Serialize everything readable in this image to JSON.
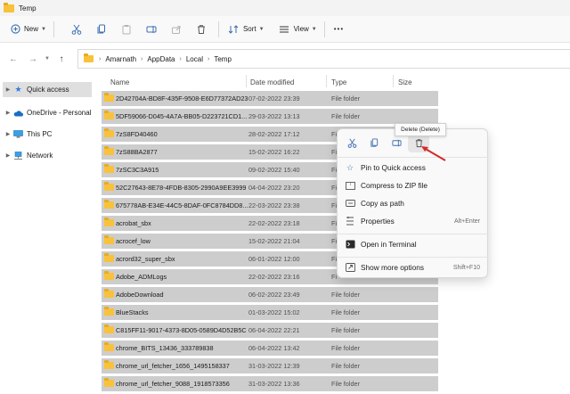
{
  "window": {
    "title": "Temp"
  },
  "toolbar": {
    "new_label": "New",
    "sort_label": "Sort",
    "view_label": "View",
    "more_label": "•••"
  },
  "address": {
    "crumbs": [
      "Amarnath",
      "AppData",
      "Local",
      "Temp"
    ],
    "separator": "›"
  },
  "sidebar": {
    "items": [
      {
        "label": "Quick access",
        "icon": "star-icon"
      },
      {
        "label": "OneDrive - Personal",
        "icon": "cloud-icon"
      },
      {
        "label": "This PC",
        "icon": "computer-icon"
      },
      {
        "label": "Network",
        "icon": "network-icon"
      }
    ]
  },
  "columns": {
    "name": "Name",
    "date": "Date modified",
    "type": "Type",
    "size": "Size"
  },
  "files": [
    {
      "name": "2D42704A-BD8F-435F-9508-E6D77372AD23",
      "date": "07-02-2022 23:39",
      "type": "File folder"
    },
    {
      "name": "5DF59066-D045-4A7A-BB05-D223721CD1...",
      "date": "29-03-2022 13:13",
      "type": "File folder"
    },
    {
      "name": "7zS8FD40460",
      "date": "28-02-2022 17:12",
      "type": "Fi"
    },
    {
      "name": "7zS88BA2877",
      "date": "15-02-2022 16:22",
      "type": "Fi"
    },
    {
      "name": "7zSC3C3A915",
      "date": "09-02-2022 15:40",
      "type": "Fi"
    },
    {
      "name": "52C27643-8E78-4FDB-8305-2990A9EE3999",
      "date": "04-04-2022 23:20",
      "type": "Fi"
    },
    {
      "name": "675778AB-E34E-44C5-8DAF-0FC8784DD8...",
      "date": "22-03-2022 23:38",
      "type": "Fi"
    },
    {
      "name": "acrobat_sbx",
      "date": "22-02-2022 23:18",
      "type": "Fi"
    },
    {
      "name": "acrocef_low",
      "date": "15-02-2022 21:04",
      "type": "Fi"
    },
    {
      "name": "acrord32_super_sbx",
      "date": "06-01-2022 12:00",
      "type": "Fi"
    },
    {
      "name": "Adobe_ADMLogs",
      "date": "22-02-2022 23:16",
      "type": "Fi"
    },
    {
      "name": "AdobeDownload",
      "date": "06-02-2022 23:49",
      "type": "File folder"
    },
    {
      "name": "BlueStacks",
      "date": "01-03-2022 15:02",
      "type": "File folder"
    },
    {
      "name": "C815FF11-9017-4373-8D05-0589D4D52B5C",
      "date": "06-04-2022 22:21",
      "type": "File folder"
    },
    {
      "name": "chrome_BITS_13436_333789838",
      "date": "06-04-2022 13:42",
      "type": "File folder"
    },
    {
      "name": "chrome_url_fetcher_1656_1495158337",
      "date": "31-03-2022 12:39",
      "type": "File folder"
    },
    {
      "name": "chrome_url_fetcher_9088_1918573356",
      "date": "31-03-2022 13:36",
      "type": "File folder"
    }
  ],
  "context_menu": {
    "tooltip": "Delete (Delete)",
    "items": [
      {
        "label": "Pin to Quick access",
        "icon": "star-icon",
        "shortcut": ""
      },
      {
        "label": "Compress to ZIP file",
        "icon": "zip-icon",
        "shortcut": ""
      },
      {
        "label": "Copy as path",
        "icon": "copy-path-icon",
        "shortcut": ""
      },
      {
        "label": "Properties",
        "icon": "properties-icon",
        "shortcut": "Alt+Enter"
      },
      {
        "label": "Open in Terminal",
        "icon": "terminal-icon",
        "shortcut": ""
      },
      {
        "label": "Show more options",
        "icon": "more-options-icon",
        "shortcut": "Shift+F10"
      }
    ]
  },
  "colors": {
    "accent": "#3a6fb0",
    "folder": "#f8c23a",
    "selection": "#cdcdcd",
    "annotation": "#d62a2a"
  }
}
